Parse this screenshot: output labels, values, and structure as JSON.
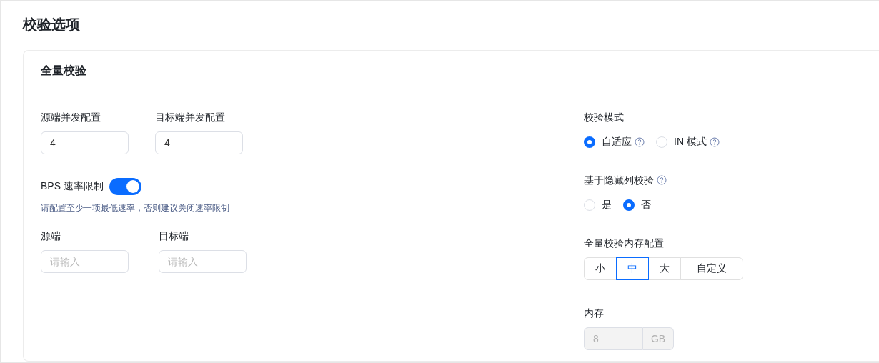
{
  "page_title": "校验选项",
  "card": {
    "title": "全量校验",
    "concurrency": [
      {
        "label": "源端并发配置",
        "value": "4"
      },
      {
        "label": "目标端并发配置",
        "value": "4"
      }
    ],
    "bps_limit": {
      "label": "BPS 速率限制",
      "on": true,
      "hint": "请配置至少一项最低速率，否则建议关闭速率限制"
    },
    "rate_fields": [
      {
        "label": "源端",
        "placeholder": "请输入"
      },
      {
        "label": "目标端",
        "placeholder": "请输入"
      }
    ],
    "check_mode": {
      "label": "校验模式",
      "options": [
        {
          "label": "自适应",
          "selected": true,
          "help": true
        },
        {
          "label": "IN 模式",
          "selected": false,
          "help": true
        }
      ]
    },
    "hidden_column_check": {
      "label": "基于隐藏列校验",
      "help": true,
      "options": [
        {
          "label": "是",
          "selected": false,
          "help": false
        },
        {
          "label": "否",
          "selected": true,
          "help": false
        }
      ]
    },
    "memory_config": {
      "label": "全量校验内存配置",
      "options": [
        {
          "label": "小",
          "selected": false
        },
        {
          "label": "中",
          "selected": true
        },
        {
          "label": "大",
          "selected": false
        },
        {
          "label": "自定义",
          "selected": false
        }
      ]
    },
    "memory": {
      "label": "内存",
      "value": "8",
      "unit": "GB",
      "disabled": true
    }
  }
}
